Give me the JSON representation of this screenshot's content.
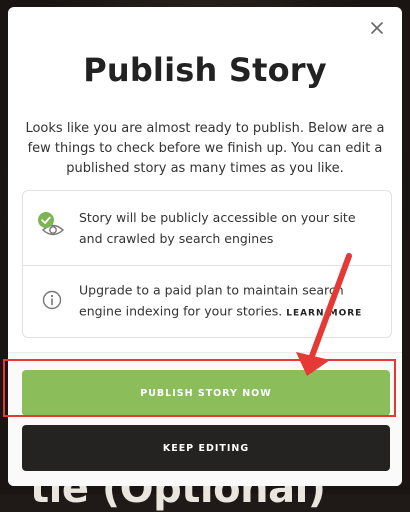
{
  "background": {
    "partial_heading": "tle (Optional)"
  },
  "modal": {
    "title": "Publish Story",
    "intro": "Looks like you are almost ready to publish. Below are a few things to check before we finish up. You can edit a published story as many times as you like.",
    "checklist": [
      {
        "icon": "eye-check-icon",
        "text": "Story will be publicly accessible on your site and crawled by search engines"
      },
      {
        "icon": "info-icon",
        "text": "Upgrade to a paid plan to maintain search engine indexing for your stories.",
        "link": "LEARN MORE"
      }
    ],
    "primary_button": "PUBLISH STORY NOW",
    "secondary_button": "KEEP EDITING"
  },
  "colors": {
    "accent_green": "#8bbe5b",
    "dark_button": "#252321",
    "annotation_red": "#e53935"
  }
}
